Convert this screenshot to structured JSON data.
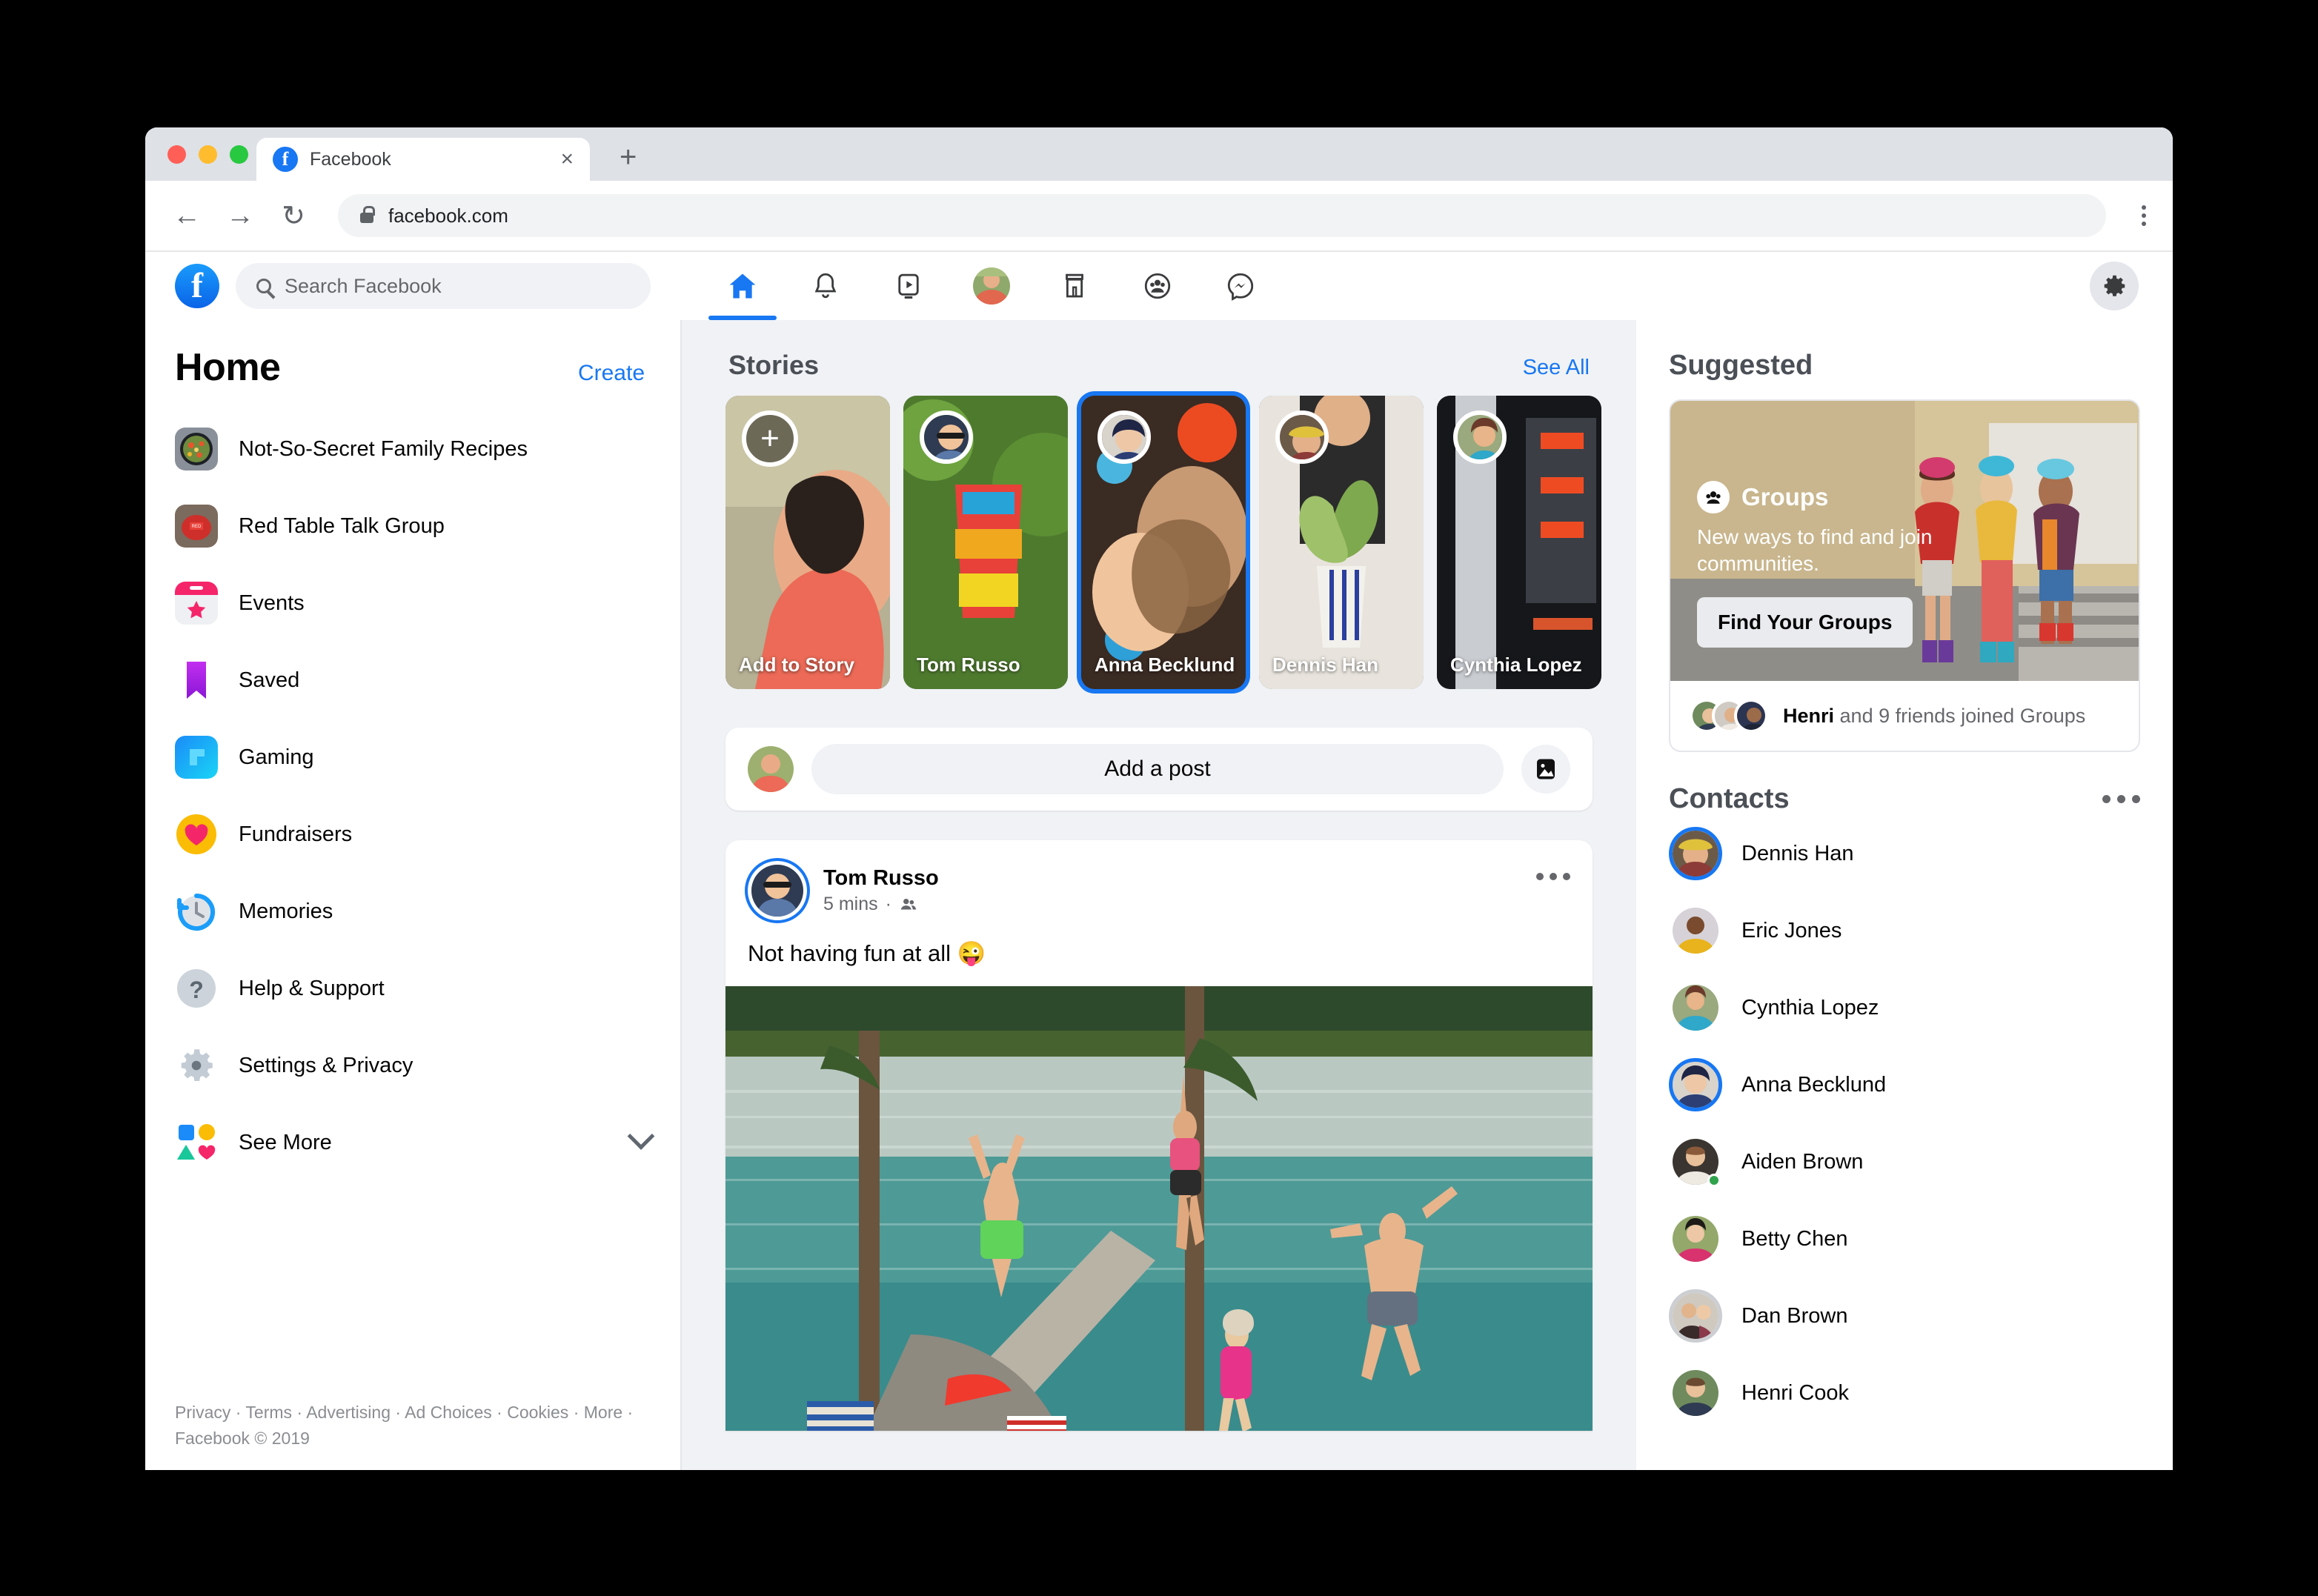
{
  "browser": {
    "tab_title": "Facebook",
    "tab_close": "×",
    "new_tab": "+",
    "back": "←",
    "forward": "→",
    "reload": "↻",
    "url": "facebook.com"
  },
  "header": {
    "logo_letter": "f",
    "search_placeholder": "Search Facebook",
    "nav": [
      {
        "name": "home",
        "active": true
      },
      {
        "name": "notifications",
        "active": false
      },
      {
        "name": "watch",
        "active": false
      },
      {
        "name": "profile",
        "active": false
      },
      {
        "name": "marketplace",
        "active": false
      },
      {
        "name": "groups",
        "active": false
      },
      {
        "name": "messenger",
        "active": false
      }
    ]
  },
  "sidebar": {
    "title": "Home",
    "create": "Create",
    "items": [
      {
        "label": "Not-So-Secret Family Recipes",
        "icon": "photo-recipes"
      },
      {
        "label": "Red Table Talk Group",
        "icon": "photo-redtable"
      },
      {
        "label": "Events",
        "icon": "events-icon"
      },
      {
        "label": "Saved",
        "icon": "bookmark-icon"
      },
      {
        "label": "Gaming",
        "icon": "gaming-icon"
      },
      {
        "label": "Fundraisers",
        "icon": "heart-icon"
      },
      {
        "label": "Memories",
        "icon": "clock-icon"
      },
      {
        "label": "Help & Support",
        "icon": "question-icon"
      },
      {
        "label": "Settings & Privacy",
        "icon": "gear-icon"
      },
      {
        "label": "See More",
        "icon": "shapes-icon"
      }
    ],
    "footer": "Privacy · Terms · Advertising · Ad Choices · Cookies · More · Facebook © 2019"
  },
  "feed": {
    "stories_title": "Stories",
    "see_all": "See All",
    "stories": [
      {
        "name": "Add to Story",
        "type": "add"
      },
      {
        "name": "Tom Russo",
        "type": "story",
        "unseen": false
      },
      {
        "name": "Anna Becklund",
        "type": "story",
        "unseen": true
      },
      {
        "name": "Dennis Han",
        "type": "story",
        "unseen": false
      },
      {
        "name": "Cynthia Lopez",
        "type": "story",
        "unseen": false
      }
    ],
    "composer_placeholder": "Add a post",
    "post": {
      "author": "Tom Russo",
      "time": "5 mins",
      "audience": "friends",
      "text": "Not having fun at all 😜"
    }
  },
  "rail": {
    "suggested_title": "Suggested",
    "suggested": {
      "brand": "Groups",
      "subtitle": "New ways to find and join communities.",
      "button": "Find Your Groups",
      "footer_bold": "Henri",
      "footer_rest": " and 9 friends joined Groups"
    },
    "contacts_title": "Contacts",
    "contacts": [
      {
        "name": "Dennis Han",
        "ring": "blue",
        "online": false
      },
      {
        "name": "Eric Jones",
        "ring": "none",
        "online": false
      },
      {
        "name": "Cynthia Lopez",
        "ring": "none",
        "online": false
      },
      {
        "name": "Anna Becklund",
        "ring": "blue",
        "online": false
      },
      {
        "name": "Aiden Brown",
        "ring": "none",
        "online": true
      },
      {
        "name": "Betty Chen",
        "ring": "none",
        "online": false
      },
      {
        "name": "Dan Brown",
        "ring": "gray",
        "online": false
      },
      {
        "name": "Henri Cook",
        "ring": "none",
        "online": false
      }
    ]
  },
  "colors": {
    "brand": "#1877f2",
    "bg": "#f0f2f5",
    "text": "#050505",
    "muted": "#65676b",
    "online": "#31a24c"
  }
}
